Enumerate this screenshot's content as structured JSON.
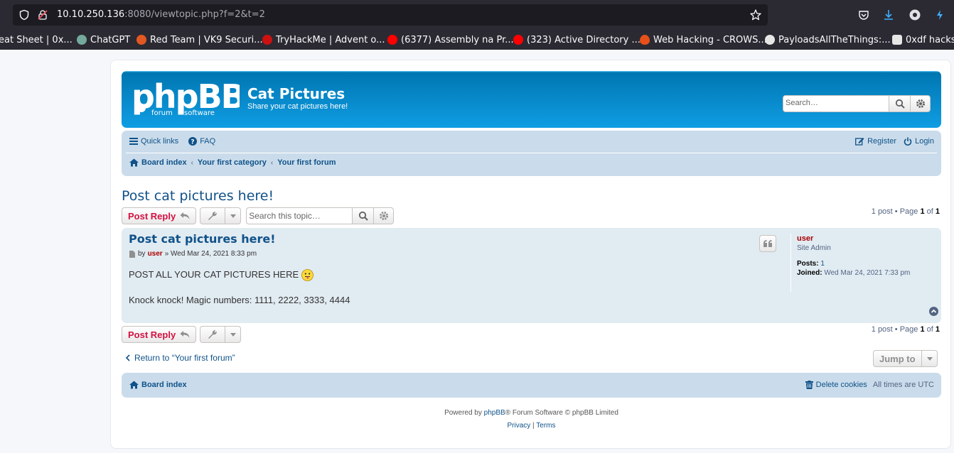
{
  "browser": {
    "url_host": "10.10.250.136",
    "url_rest": ":8080/viewtopic.php?f=2&t=2",
    "bookmarks": [
      {
        "label": "eat Sheet | 0x...",
        "color": "#2b2a33"
      },
      {
        "label": "ChatGPT",
        "color": "#74aa9c"
      },
      {
        "label": "Red Team | VK9 Securi...",
        "color": "#e25822"
      },
      {
        "label": "TryHackMe | Advent o...",
        "color": "#c11"
      },
      {
        "label": "(6377) Assembly na Pr...",
        "color": "#ff0000"
      },
      {
        "label": "(323) Active Directory ...",
        "color": "#ff0000"
      },
      {
        "label": "Web Hacking - CROWS...",
        "color": "#e8501a"
      },
      {
        "label": "PayloadsAllTheThings:...",
        "color": "#e6e6e6"
      },
      {
        "label": "0xdf hacks",
        "color": "#e6e6e6"
      }
    ]
  },
  "header": {
    "site_title": "Cat Pictures",
    "site_desc": "Share your cat pictures here!",
    "search_placeholder": "Search…"
  },
  "nav": {
    "quick_links": "Quick links",
    "faq": "FAQ",
    "register": "Register",
    "login": "Login",
    "breadcrumbs": [
      "Board index",
      "Your first category",
      "Your first forum"
    ]
  },
  "topic": {
    "title": "Post cat pictures here!",
    "post_reply": "Post Reply",
    "search_placeholder": "Search this topic…",
    "pagination": {
      "prefix": "1 post • Page ",
      "page": "1",
      "of": " of ",
      "total": "1"
    }
  },
  "post": {
    "title": "Post cat pictures here!",
    "by": "by",
    "author": "user",
    "date": "» Wed Mar 24, 2021 8:33 pm",
    "line1": "POST ALL YOUR CAT PICTURES HERE",
    "line2": "Knock knock! Magic numbers: 1111, 2222, 3333, 4444",
    "profile": {
      "username": "user",
      "rank": "Site Admin",
      "posts_label": "Posts:",
      "posts_value": "1",
      "joined_label": "Joined:",
      "joined_value": "Wed Mar 24, 2021 7:33 pm"
    }
  },
  "bottom": {
    "return_link": "Return to “Your first forum”",
    "jump_to": "Jump to"
  },
  "footer": {
    "board_index": "Board index",
    "delete_cookies": "Delete cookies",
    "timezone": "All times are UTC",
    "powered_prefix": "Powered by ",
    "powered_link": "phpBB",
    "powered_suffix": "® Forum Software © phpBB Limited",
    "privacy": "Privacy",
    "sep": " | ",
    "terms": "Terms"
  },
  "colors": {
    "accent": "#105289",
    "header": "#12a3eb",
    "nav": "#cadceb",
    "post": "#e1ebf2",
    "reply": "#d31141",
    "admin": "#aa0000"
  }
}
